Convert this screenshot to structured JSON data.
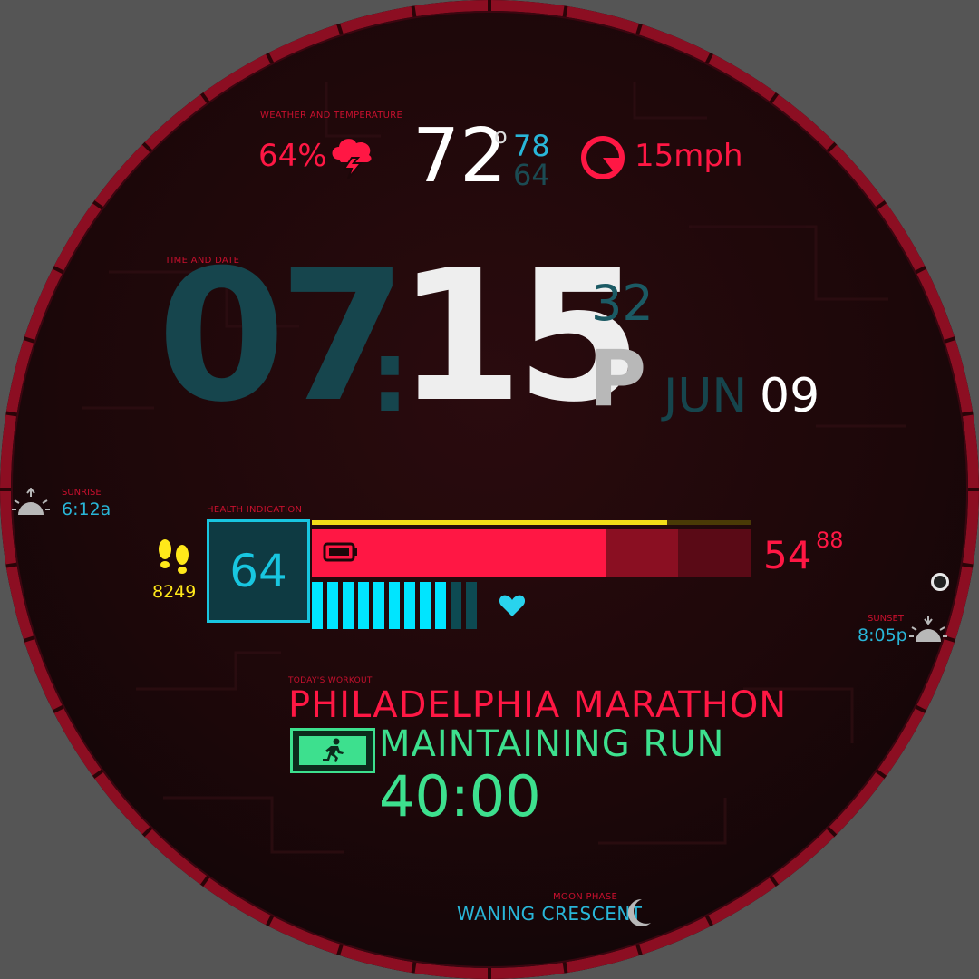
{
  "weather": {
    "section_label": "WEATHER AND TEMPERATURE",
    "humidity": "64%",
    "icon": "storm-cloud-icon",
    "temperature": "72",
    "degree_symbol": "o",
    "high": "78",
    "low": "64",
    "wind_icon": "wind-gauge-icon",
    "wind_speed": "15mph"
  },
  "time": {
    "section_label": "TIME AND DATE",
    "hour": "07",
    "colon": ":",
    "minute": "15",
    "seconds": "32",
    "ampm": "P",
    "month": "JUN",
    "day": "09"
  },
  "sunrise": {
    "label": "SUNRISE",
    "time": "6:12a",
    "icon": "sunrise-icon"
  },
  "sunset": {
    "label": "SUNSET",
    "time": "8:05p",
    "icon": "sunset-icon"
  },
  "health": {
    "section_label": "HEALTH INDICATION",
    "score": "64",
    "steps": "8249",
    "steps_icon": "footsteps-icon",
    "battery_icon": "battery-icon",
    "heart_icon": "heart-icon",
    "heart_rate": "54",
    "heart_rate_max": "88",
    "step_goal_progress": 0.81,
    "battery_level": 0.67,
    "heart_zone_segments_on": 9,
    "heart_zone_segments_total": 11
  },
  "workout": {
    "section_label": "TODAY'S WORKOUT",
    "title": "PHILADELPHIA MARATHON",
    "type": "MAINTAINING RUN",
    "duration": "40:00",
    "icon": "runner-icon"
  },
  "moon": {
    "section_label": "MOON PHASE",
    "phase": "WANING CRESCENT",
    "icon": "crescent-moon-icon"
  },
  "colors": {
    "accent_red": "#ff1744",
    "accent_cyan": "#00e5ff",
    "accent_green": "#3de08e",
    "accent_yellow": "#f2dd18",
    "ring": "#8c0e22"
  }
}
